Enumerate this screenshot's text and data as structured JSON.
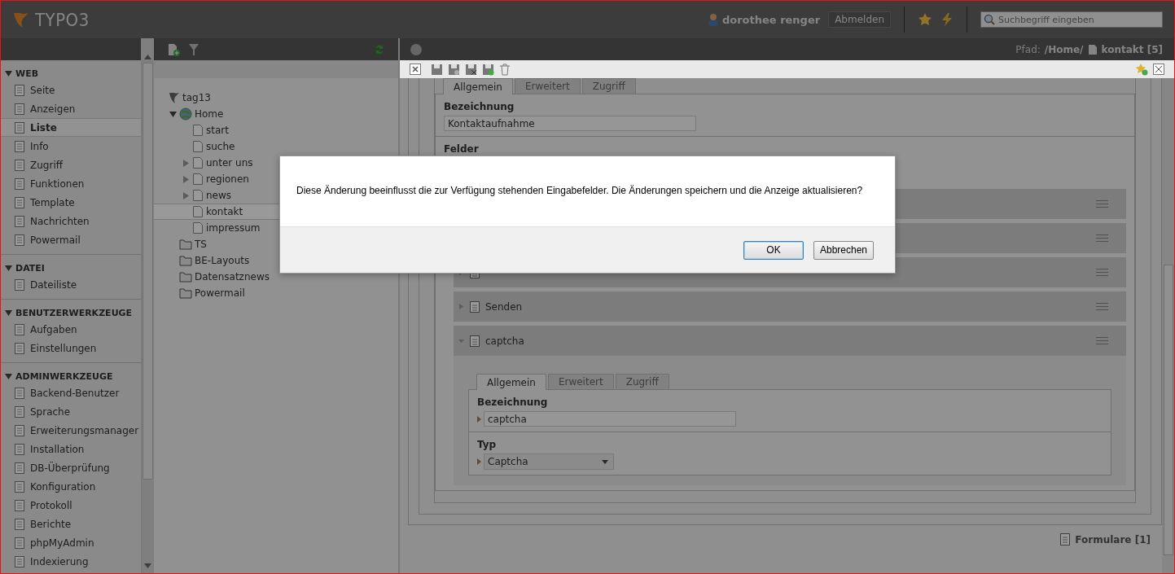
{
  "topbar": {
    "logo": "TYPO3",
    "user": "dorothee renger",
    "logout": "Abmelden",
    "search": {
      "placeholder": "Suchbegriff eingeben"
    }
  },
  "module_menu": {
    "sections": [
      {
        "title": "WEB",
        "expanded": true,
        "items": [
          {
            "label": "Seite",
            "selected": false
          },
          {
            "label": "Anzeigen",
            "selected": false
          },
          {
            "label": "Liste",
            "selected": true
          },
          {
            "label": "Info",
            "selected": false
          },
          {
            "label": "Zugriff",
            "selected": false
          },
          {
            "label": "Funktionen",
            "selected": false
          },
          {
            "label": "Template",
            "selected": false
          },
          {
            "label": "Nachrichten",
            "selected": false
          },
          {
            "label": "Powermail",
            "selected": false
          }
        ]
      },
      {
        "title": "DATEI",
        "expanded": true,
        "items": [
          {
            "label": "Dateiliste",
            "selected": false
          }
        ]
      },
      {
        "title": "BENUTZERWERKZEUGE",
        "expanded": true,
        "items": [
          {
            "label": "Aufgaben",
            "selected": false
          },
          {
            "label": "Einstellungen",
            "selected": false
          }
        ]
      },
      {
        "title": "ADMINWERKZEUGE",
        "expanded": true,
        "items": [
          {
            "label": "Backend-Benutzer",
            "selected": false
          },
          {
            "label": "Sprache",
            "selected": false
          },
          {
            "label": "Erweiterungsmanager",
            "selected": false
          },
          {
            "label": "Installation",
            "selected": false
          },
          {
            "label": "DB-Überprüfung",
            "selected": false
          },
          {
            "label": "Konfiguration",
            "selected": false
          },
          {
            "label": "Protokoll",
            "selected": false
          },
          {
            "label": "Berichte",
            "selected": false
          },
          {
            "label": "phpMyAdmin",
            "selected": false
          },
          {
            "label": "Indexierung",
            "selected": false
          }
        ]
      }
    ]
  },
  "page_tree": {
    "root": "tag13",
    "nodes": [
      {
        "label": "Home",
        "kind": "site",
        "selected": false,
        "expanded": true,
        "children": [
          {
            "label": "start",
            "kind": "page",
            "selected": false
          },
          {
            "label": "suche",
            "kind": "page",
            "selected": false
          },
          {
            "label": "unter uns",
            "kind": "page",
            "selected": false,
            "expanded": false
          },
          {
            "label": "regionen",
            "kind": "page",
            "selected": false,
            "expanded": false
          },
          {
            "label": "news",
            "kind": "page",
            "selected": false,
            "expanded": false
          },
          {
            "label": "kontakt",
            "kind": "page",
            "selected": true
          },
          {
            "label": "impressum",
            "kind": "page",
            "selected": false
          }
        ]
      },
      {
        "label": "TS",
        "kind": "folder",
        "selected": false
      },
      {
        "label": "BE-Layouts",
        "kind": "folder",
        "selected": false
      },
      {
        "label": "Datensatznews",
        "kind": "folder",
        "selected": false
      },
      {
        "label": "Powermail",
        "kind": "folder",
        "selected": false
      }
    ]
  },
  "content": {
    "path_label": "Pfad:",
    "path": "/Home/",
    "page": "kontakt [5]",
    "tabs": [
      {
        "label": "Allgemein",
        "selected": true
      },
      {
        "label": "Erweitert",
        "selected": false
      },
      {
        "label": "Zugriff",
        "selected": false
      }
    ],
    "name_label": "Bezeichnung",
    "name_value": "Kontaktaufnahme",
    "fields_label": "Felder",
    "fields": [
      {
        "expanded": false
      },
      {
        "expanded": false
      },
      {
        "expanded": false
      },
      {
        "label": "Senden",
        "expanded": false
      },
      {
        "label": "captcha",
        "expanded": true,
        "tabs": [
          {
            "label": "Allgemein",
            "selected": true
          },
          {
            "label": "Erweitert",
            "selected": false
          },
          {
            "label": "Zugriff",
            "selected": false
          }
        ],
        "name_label": "Bezeichnung",
        "name_value": "captcha",
        "type_label": "Typ",
        "type_value": "Captcha"
      }
    ],
    "footer": "Formulare [1]"
  },
  "dialog": {
    "message": "Diese Änderung beeinflusst die zur Verfügung stehenden Eingabefelder. Die Änderungen speichern und die Anzeige aktualisieren?",
    "buttons": [
      {
        "label": "OK",
        "selected": true
      },
      {
        "label": "Abbrechen",
        "selected": false
      }
    ]
  }
}
